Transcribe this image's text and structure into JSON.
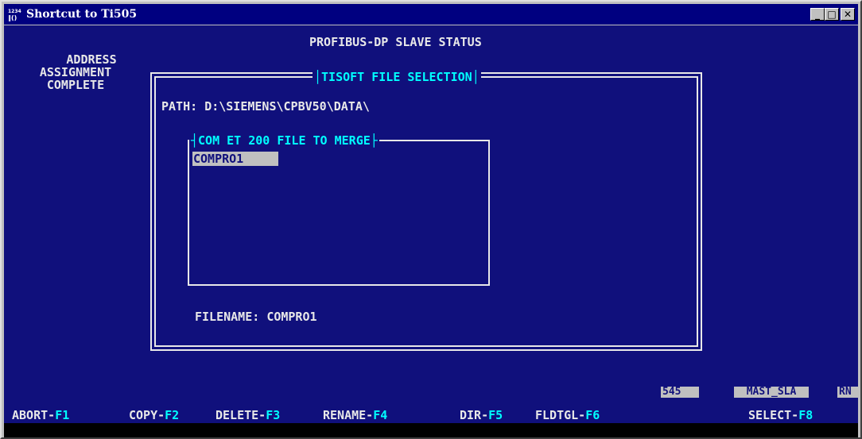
{
  "window": {
    "title": "Shortcut to Ti505",
    "icon": "ms-dos-icon",
    "icon_text": "¹²³⁴\n⃦()"
  },
  "screen": {
    "header": "PROFIBUS-DP SLAVE STATUS",
    "status_message": [
      "ADDRESS",
      "ASSIGNMENT",
      "COMPLETE"
    ],
    "dialog": {
      "title": "TISOFT FILE SELECTION",
      "path_label": "PATH:",
      "path_value": "D:\\SIEMENS\\CPBV50\\DATA\\",
      "list_title": "COM ET 200 FILE TO MERGE",
      "files": [
        "COMPRO1"
      ],
      "selected_file": "COMPRO1",
      "filename_label": "FILENAME:",
      "filename_value": "COMPRO1"
    },
    "status_fields": [
      "545",
      "MAST_SLA",
      "RN"
    ],
    "function_keys": [
      {
        "label": "ABORT-",
        "key": "F1"
      },
      {
        "label": "COPY-",
        "key": "F2"
      },
      {
        "label": "DELETE-",
        "key": "F3"
      },
      {
        "label": "RENAME-",
        "key": "F4"
      },
      {
        "label": "DIR-",
        "key": "F5"
      },
      {
        "label": "FLDTGL-",
        "key": "F6"
      },
      {
        "label": "SELECT-",
        "key": "F8"
      }
    ]
  },
  "colors": {
    "screen_background": "#10107c",
    "text": "#e8e8e8",
    "highlight": "#00ffff",
    "selection": "#c0c0c0",
    "titlebar": "#000080"
  }
}
